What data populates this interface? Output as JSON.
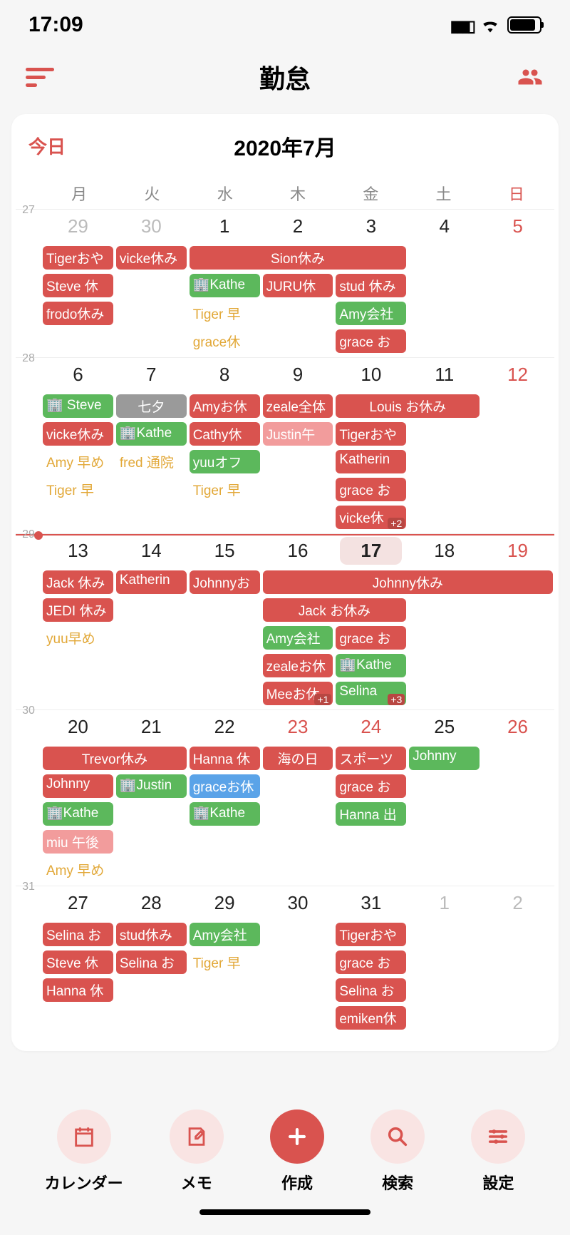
{
  "status": {
    "time": "17:09"
  },
  "header": {
    "title": "勤怠"
  },
  "calendar": {
    "today_label": "今日",
    "month_title": "2020年7月",
    "today_day": 17,
    "weekdays": [
      "月",
      "火",
      "水",
      "木",
      "金",
      "土",
      "日"
    ],
    "weeks": [
      {
        "num": "27",
        "days": [
          {
            "n": "29",
            "cls": "other"
          },
          {
            "n": "30",
            "cls": "other"
          },
          {
            "n": "1"
          },
          {
            "n": "2"
          },
          {
            "n": "3"
          },
          {
            "n": "4"
          },
          {
            "n": "5",
            "cls": "sun"
          }
        ],
        "rows": [
          [
            {
              "c": 1,
              "s": 1,
              "t": "Tigerおや",
              "k": "red"
            },
            {
              "c": 2,
              "s": 1,
              "t": "vicke休み",
              "k": "red"
            },
            {
              "c": 3,
              "s": 3,
              "t": "Sion休み",
              "k": "red",
              "ctr": true
            }
          ],
          [
            {
              "c": 1,
              "s": 1,
              "t": "Steve 休",
              "k": "red"
            },
            {
              "c": 3,
              "s": 1,
              "t": "🏢Kathe",
              "k": "green"
            },
            {
              "c": 4,
              "s": 1,
              "t": "JURU休",
              "k": "red"
            },
            {
              "c": 5,
              "s": 1,
              "t": "stud 休み",
              "k": "red"
            }
          ],
          [
            {
              "c": 1,
              "s": 1,
              "t": "frodo休み",
              "k": "red"
            },
            {
              "c": 3,
              "s": 1,
              "t": "Tiger 早",
              "k": "ylw"
            },
            {
              "c": 5,
              "s": 1,
              "t": "Amy会社",
              "k": "green"
            }
          ],
          [
            {
              "c": 3,
              "s": 1,
              "t": "grace休",
              "k": "ylw"
            },
            {
              "c": 5,
              "s": 1,
              "t": "grace お",
              "k": "red"
            }
          ]
        ]
      },
      {
        "num": "28",
        "days": [
          {
            "n": "6"
          },
          {
            "n": "7"
          },
          {
            "n": "8"
          },
          {
            "n": "9"
          },
          {
            "n": "10"
          },
          {
            "n": "11"
          },
          {
            "n": "12",
            "cls": "sun"
          }
        ],
        "rows": [
          [
            {
              "c": 1,
              "s": 1,
              "t": "🏢 Steve",
              "k": "green"
            },
            {
              "c": 2,
              "s": 1,
              "t": "七夕",
              "k": "gray",
              "ctr": true
            },
            {
              "c": 3,
              "s": 1,
              "t": "Amyお休",
              "k": "red"
            },
            {
              "c": 4,
              "s": 1,
              "t": "zeale全体",
              "k": "red"
            },
            {
              "c": 5,
              "s": 2,
              "t": "Louis お休み",
              "k": "red",
              "ctr": true
            }
          ],
          [
            {
              "c": 1,
              "s": 1,
              "t": "vicke休み",
              "k": "red"
            },
            {
              "c": 2,
              "s": 1,
              "t": "🏢Kathe",
              "k": "green"
            },
            {
              "c": 3,
              "s": 1,
              "t": "Cathy休",
              "k": "red"
            },
            {
              "c": 4,
              "s": 1,
              "t": "Justin午",
              "k": "pink"
            },
            {
              "c": 5,
              "s": 1,
              "t": "Tigerおや",
              "k": "red"
            }
          ],
          [
            {
              "c": 1,
              "s": 1,
              "t": "Amy 早め",
              "k": "ylw"
            },
            {
              "c": 2,
              "s": 1,
              "t": "fred 通院",
              "k": "ylw"
            },
            {
              "c": 3,
              "s": 1,
              "t": "yuuオフ",
              "k": "green"
            },
            {
              "c": 5,
              "s": 1,
              "t": "Katherin",
              "k": "red"
            }
          ],
          [
            {
              "c": 1,
              "s": 1,
              "t": "Tiger 早",
              "k": "ylw"
            },
            {
              "c": 3,
              "s": 1,
              "t": "Tiger 早",
              "k": "ylw"
            },
            {
              "c": 5,
              "s": 1,
              "t": "grace お",
              "k": "red"
            }
          ],
          [
            {
              "c": 5,
              "s": 1,
              "t": "vicke休",
              "k": "red",
              "more": "+2"
            }
          ]
        ]
      },
      {
        "num": "29",
        "now": true,
        "days": [
          {
            "n": "13"
          },
          {
            "n": "14"
          },
          {
            "n": "15"
          },
          {
            "n": "16"
          },
          {
            "n": "17",
            "cls": "today"
          },
          {
            "n": "18"
          },
          {
            "n": "19",
            "cls": "sun"
          }
        ],
        "rows": [
          [
            {
              "c": 1,
              "s": 1,
              "t": "Jack 休み",
              "k": "red"
            },
            {
              "c": 2,
              "s": 1,
              "t": "Katherin",
              "k": "red"
            },
            {
              "c": 3,
              "s": 1,
              "t": "Johnnyお",
              "k": "red"
            },
            {
              "c": 4,
              "s": 4,
              "t": "Johnny休み",
              "k": "red",
              "ctr": true
            }
          ],
          [
            {
              "c": 1,
              "s": 1,
              "t": "JEDI 休み",
              "k": "red"
            },
            {
              "c": 4,
              "s": 2,
              "t": "Jack お休み",
              "k": "red",
              "ctr": true
            }
          ],
          [
            {
              "c": 1,
              "s": 1,
              "t": "yuu早め",
              "k": "ylw"
            },
            {
              "c": 4,
              "s": 1,
              "t": "Amy会社",
              "k": "green"
            },
            {
              "c": 5,
              "s": 1,
              "t": "grace お",
              "k": "red"
            }
          ],
          [
            {
              "c": 4,
              "s": 1,
              "t": "zealeお休",
              "k": "red"
            },
            {
              "c": 5,
              "s": 1,
              "t": "🏢Kathe",
              "k": "green"
            }
          ],
          [
            {
              "c": 4,
              "s": 1,
              "t": "Meeお休",
              "k": "red",
              "more": "+1"
            },
            {
              "c": 5,
              "s": 1,
              "t": "Selina ",
              "k": "green",
              "more": "+3"
            }
          ]
        ]
      },
      {
        "num": "30",
        "days": [
          {
            "n": "20"
          },
          {
            "n": "21"
          },
          {
            "n": "22"
          },
          {
            "n": "23",
            "cls": "holiday"
          },
          {
            "n": "24",
            "cls": "holiday"
          },
          {
            "n": "25"
          },
          {
            "n": "26",
            "cls": "sun"
          }
        ],
        "rows": [
          [
            {
              "c": 1,
              "s": 2,
              "t": "Trevor休み",
              "k": "red",
              "ctr": true
            },
            {
              "c": 3,
              "s": 1,
              "t": "Hanna 休",
              "k": "red"
            },
            {
              "c": 4,
              "s": 1,
              "t": "海の日",
              "k": "red",
              "ctr": true
            },
            {
              "c": 5,
              "s": 1,
              "t": "スポーツ",
              "k": "red"
            },
            {
              "c": 6,
              "s": 1,
              "t": "Johnny",
              "k": "green"
            }
          ],
          [
            {
              "c": 1,
              "s": 1,
              "t": "Johnny",
              "k": "red"
            },
            {
              "c": 2,
              "s": 1,
              "t": "🏢Justin",
              "k": "green"
            },
            {
              "c": 3,
              "s": 1,
              "t": "graceお休",
              "k": "blue"
            },
            {
              "c": 5,
              "s": 1,
              "t": "grace お",
              "k": "red"
            }
          ],
          [
            {
              "c": 1,
              "s": 1,
              "t": "🏢Kathe",
              "k": "green"
            },
            {
              "c": 3,
              "s": 1,
              "t": "🏢Kathe",
              "k": "green"
            },
            {
              "c": 5,
              "s": 1,
              "t": "Hanna 出",
              "k": "green"
            }
          ],
          [
            {
              "c": 1,
              "s": 1,
              "t": "miu 午後",
              "k": "pink"
            }
          ],
          [
            {
              "c": 1,
              "s": 1,
              "t": "Amy 早め",
              "k": "ylw"
            }
          ]
        ]
      },
      {
        "num": "31",
        "days": [
          {
            "n": "27"
          },
          {
            "n": "28"
          },
          {
            "n": "29"
          },
          {
            "n": "30"
          },
          {
            "n": "31"
          },
          {
            "n": "1",
            "cls": "other"
          },
          {
            "n": "2",
            "cls": "other"
          }
        ],
        "rows": [
          [
            {
              "c": 1,
              "s": 1,
              "t": "Selina お",
              "k": "red"
            },
            {
              "c": 2,
              "s": 1,
              "t": "stud休み",
              "k": "red"
            },
            {
              "c": 3,
              "s": 1,
              "t": "Amy会社",
              "k": "green"
            },
            {
              "c": 5,
              "s": 1,
              "t": "Tigerおや",
              "k": "red"
            }
          ],
          [
            {
              "c": 1,
              "s": 1,
              "t": "Steve 休",
              "k": "red"
            },
            {
              "c": 2,
              "s": 1,
              "t": "Selina お",
              "k": "red"
            },
            {
              "c": 3,
              "s": 1,
              "t": "Tiger 早",
              "k": "ylw"
            },
            {
              "c": 5,
              "s": 1,
              "t": "grace お",
              "k": "red"
            }
          ],
          [
            {
              "c": 1,
              "s": 1,
              "t": "Hanna 休",
              "k": "red"
            },
            {
              "c": 5,
              "s": 1,
              "t": "Selina お",
              "k": "red"
            }
          ],
          [
            {
              "c": 5,
              "s": 1,
              "t": "emiken休",
              "k": "red"
            }
          ]
        ]
      }
    ]
  },
  "nav": {
    "items": [
      {
        "label": "カレンダー",
        "icon": "calendar"
      },
      {
        "label": "メモ",
        "icon": "memo"
      },
      {
        "label": "作成",
        "icon": "plus",
        "primary": true
      },
      {
        "label": "検索",
        "icon": "search"
      },
      {
        "label": "設定",
        "icon": "settings"
      }
    ]
  }
}
